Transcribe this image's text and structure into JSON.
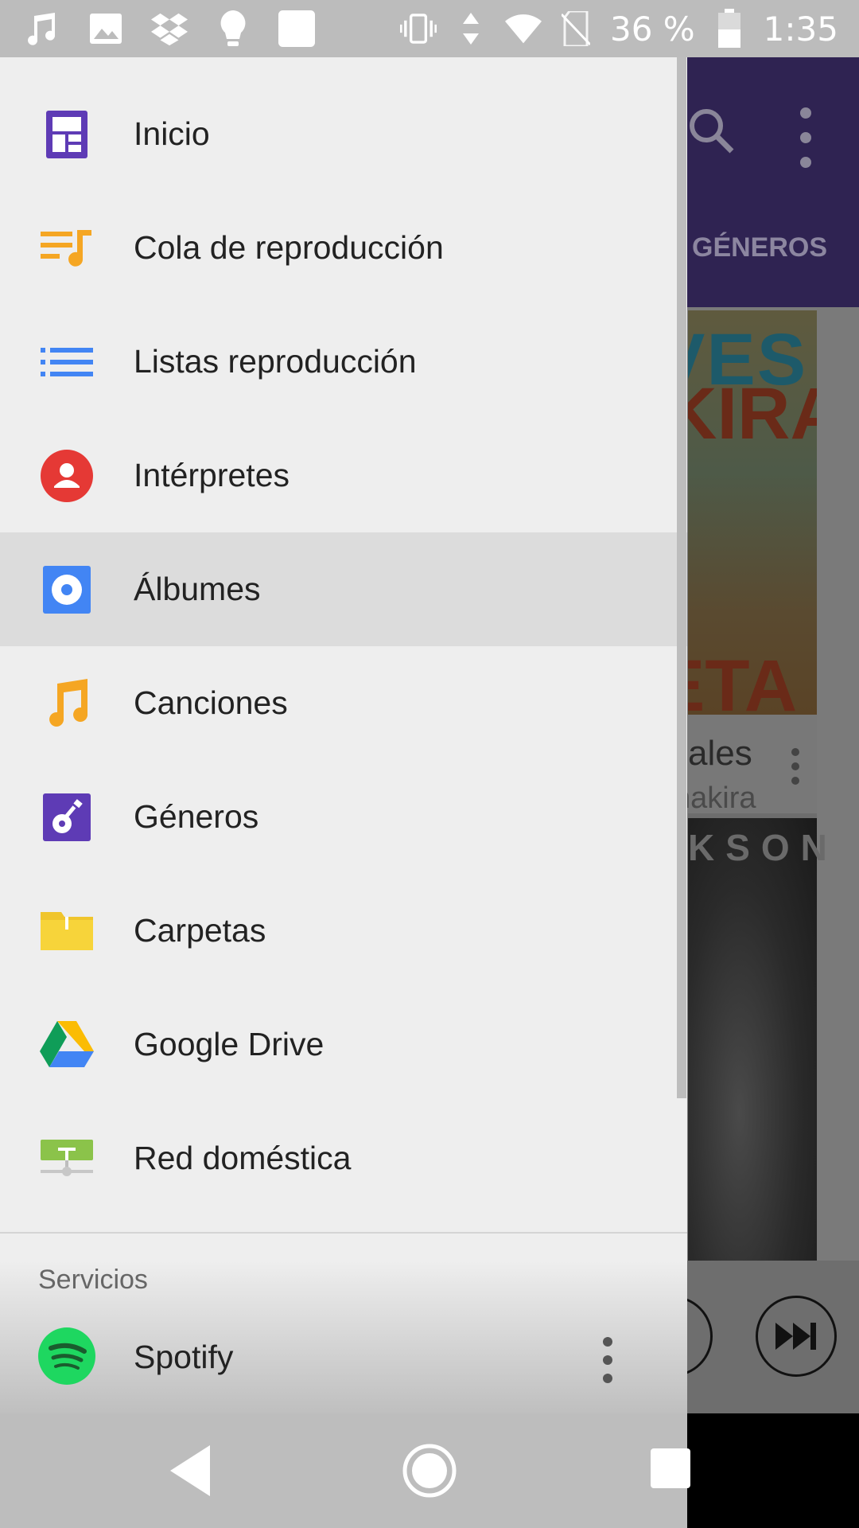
{
  "status_bar": {
    "battery_text": "36 %",
    "time": "1:35",
    "icons_left": [
      "music-note-icon",
      "image-icon",
      "dropbox-icon",
      "bulb-icon",
      "square-notification-icon"
    ],
    "icons_right": [
      "vibrate-icon",
      "data-arrows-icon",
      "wifi-icon",
      "no-sim-icon",
      "battery-icon"
    ]
  },
  "background_app": {
    "tab_label": "GÉNEROS",
    "album_title_partial": "ales",
    "album_artist_partial": "nakira",
    "art1_text": [
      "VES",
      "KIRA",
      "ETA"
    ],
    "art2_text": "KSON",
    "toolbar_color": "#2f2352"
  },
  "drawer": {
    "items": [
      {
        "label": "Inicio",
        "icon": "home-grid-icon"
      },
      {
        "label": "Cola de reproducción",
        "icon": "queue-icon"
      },
      {
        "label": "Listas reproducción",
        "icon": "playlist-icon"
      },
      {
        "label": "Intérpretes",
        "icon": "artist-icon"
      },
      {
        "label": "Álbumes",
        "icon": "album-icon",
        "selected": true
      },
      {
        "label": "Canciones",
        "icon": "song-icon"
      },
      {
        "label": "Géneros",
        "icon": "guitar-icon"
      },
      {
        "label": "Carpetas",
        "icon": "folder-icon"
      },
      {
        "label": "Google Drive",
        "icon": "google-drive-icon"
      },
      {
        "label": "Red doméstica",
        "icon": "home-network-icon"
      }
    ],
    "services_title": "Servicios",
    "spotify_label": "Spotify"
  },
  "colors": {
    "drawer_bg": "#eeeeee",
    "selected_bg": "#dcdcdc",
    "accent_purple": "#5e3bb5",
    "orange": "#f5a623",
    "blue": "#4285f4",
    "red": "#e53935",
    "spotify_green": "#1ed760"
  }
}
